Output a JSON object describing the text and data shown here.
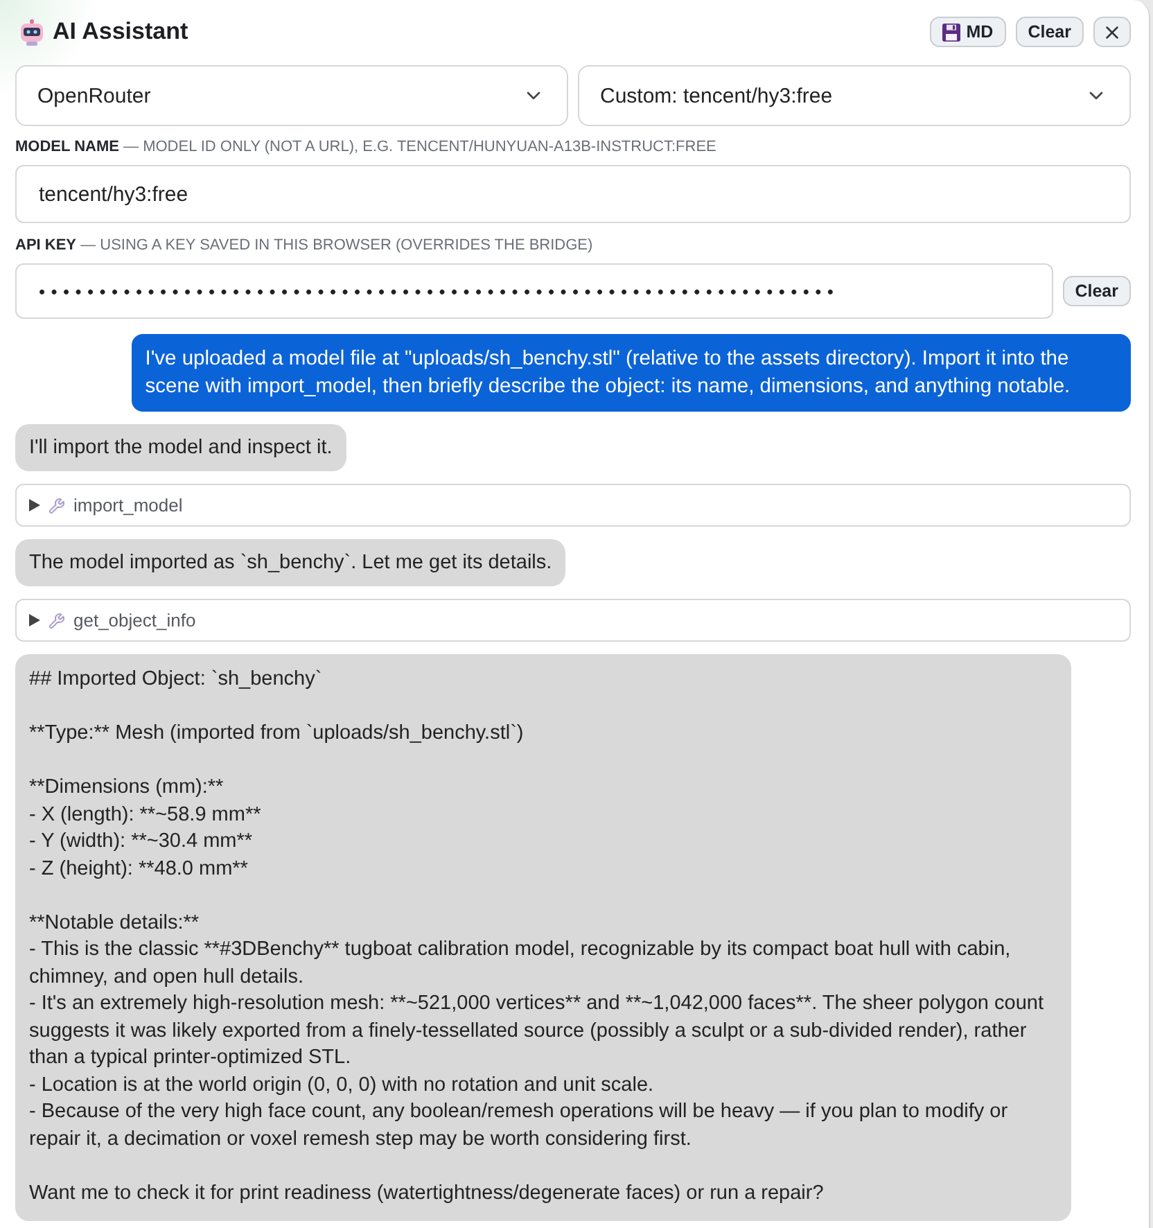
{
  "header": {
    "title": "AI Assistant",
    "buttons": [
      {
        "kind": "export",
        "label": "MD"
      },
      {
        "kind": "clear",
        "label": "Clear"
      },
      {
        "kind": "close"
      }
    ]
  },
  "provider_select": {
    "value": "OpenRouter"
  },
  "model_select": {
    "value": "Custom: tencent/hy3:free"
  },
  "model_name": {
    "label": "**MODEL NAME** — MODEL ID ONLY (NOT A URL), E.G. TENCENT/HUNYUAN-A13B-INSTRUCT:FREE",
    "value": "tencent/hy3:free"
  },
  "api_key": {
    "label": "**API KEY** — USING A KEY SAVED IN THIS BROWSER (OVERRIDES THE BRIDGE)",
    "value": "••••••••••••••••••••••••••••••••••••••••••••••••••••••••••••••••••",
    "button": "Clear"
  },
  "messages": [
    {
      "kind": "user",
      "text": "I've uploaded a model file at \"uploads/sh_benchy.stl\" (relative to the assets directory). Import it into the scene with import_model, then briefly describe the object: its name, dimensions, and anything notable."
    },
    {
      "kind": "assistant",
      "text": "I'll import the model and inspect it."
    },
    {
      "kind": "tool",
      "name": "import_model",
      "expanded": false
    },
    {
      "kind": "assistant",
      "text": "The model imported as `sh_benchy`. Let me get its details."
    },
    {
      "kind": "tool",
      "name": "get_object_info",
      "expanded": false
    },
    {
      "kind": "assistant_markdown",
      "blocks": [
        [
          "## Imported Object: `sh_benchy`"
        ],
        [
          "**Type:** Mesh (imported from `uploads/sh_benchy.stl`)"
        ],
        [
          "**Dimensions (mm):**",
          "- X (length): **~58.9 mm**",
          "- Y (width): **~30.4 mm**",
          "- Z (height): **48.0 mm**"
        ],
        [
          "**Notable details:**",
          "- This is the classic **#3DBenchy** tugboat calibration model, recognizable by its compact boat hull with cabin, chimney, and open hull details.",
          "- It's an extremely high-resolution mesh: **~521,000 vertices** and **~1,042,000 faces**. The sheer polygon count suggests it was likely exported from a finely-tessellated source (possibly a sculpt or a sub-divided render), rather than a typical printer-optimized STL.",
          "- Location is at the world origin (0, 0, 0) with no rotation and unit scale.",
          "- Because of the very high face count, any boolean/remesh operations will be heavy — if you plan to modify or repair it, a decimation or voxel remesh step may be worth considering first."
        ],
        [
          "Want me to check it for print readiness (watertightness/degenerate faces) or run a repair?"
        ]
      ]
    }
  ]
}
